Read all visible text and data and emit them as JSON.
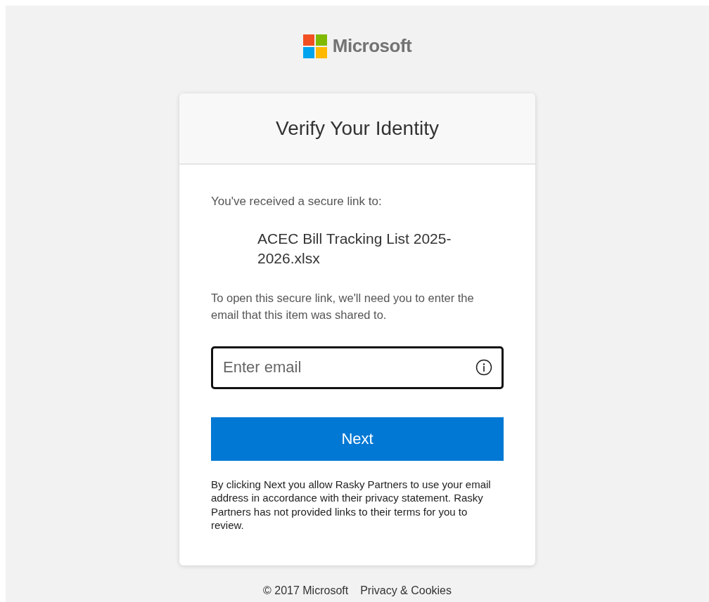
{
  "logo": {
    "text": "Microsoft"
  },
  "card": {
    "title": "Verify Your Identity",
    "intro": "You've received a secure link to:",
    "file_name": "ACEC Bill Tracking List 2025-2026.xlsx",
    "instructions": "To open this secure link, we'll need you to enter the email that this item was shared to.",
    "email_field": {
      "placeholder": "Enter email"
    },
    "button": "Next",
    "disclaimer": "By clicking Next you allow Rasky Partners to use your email address in accordance with their privacy statement. Rasky Partners has not provided links to their terms for you to review."
  },
  "footer": {
    "copyright": "© 2017 Microsoft",
    "links": [
      "Privacy & Cookies"
    ]
  }
}
